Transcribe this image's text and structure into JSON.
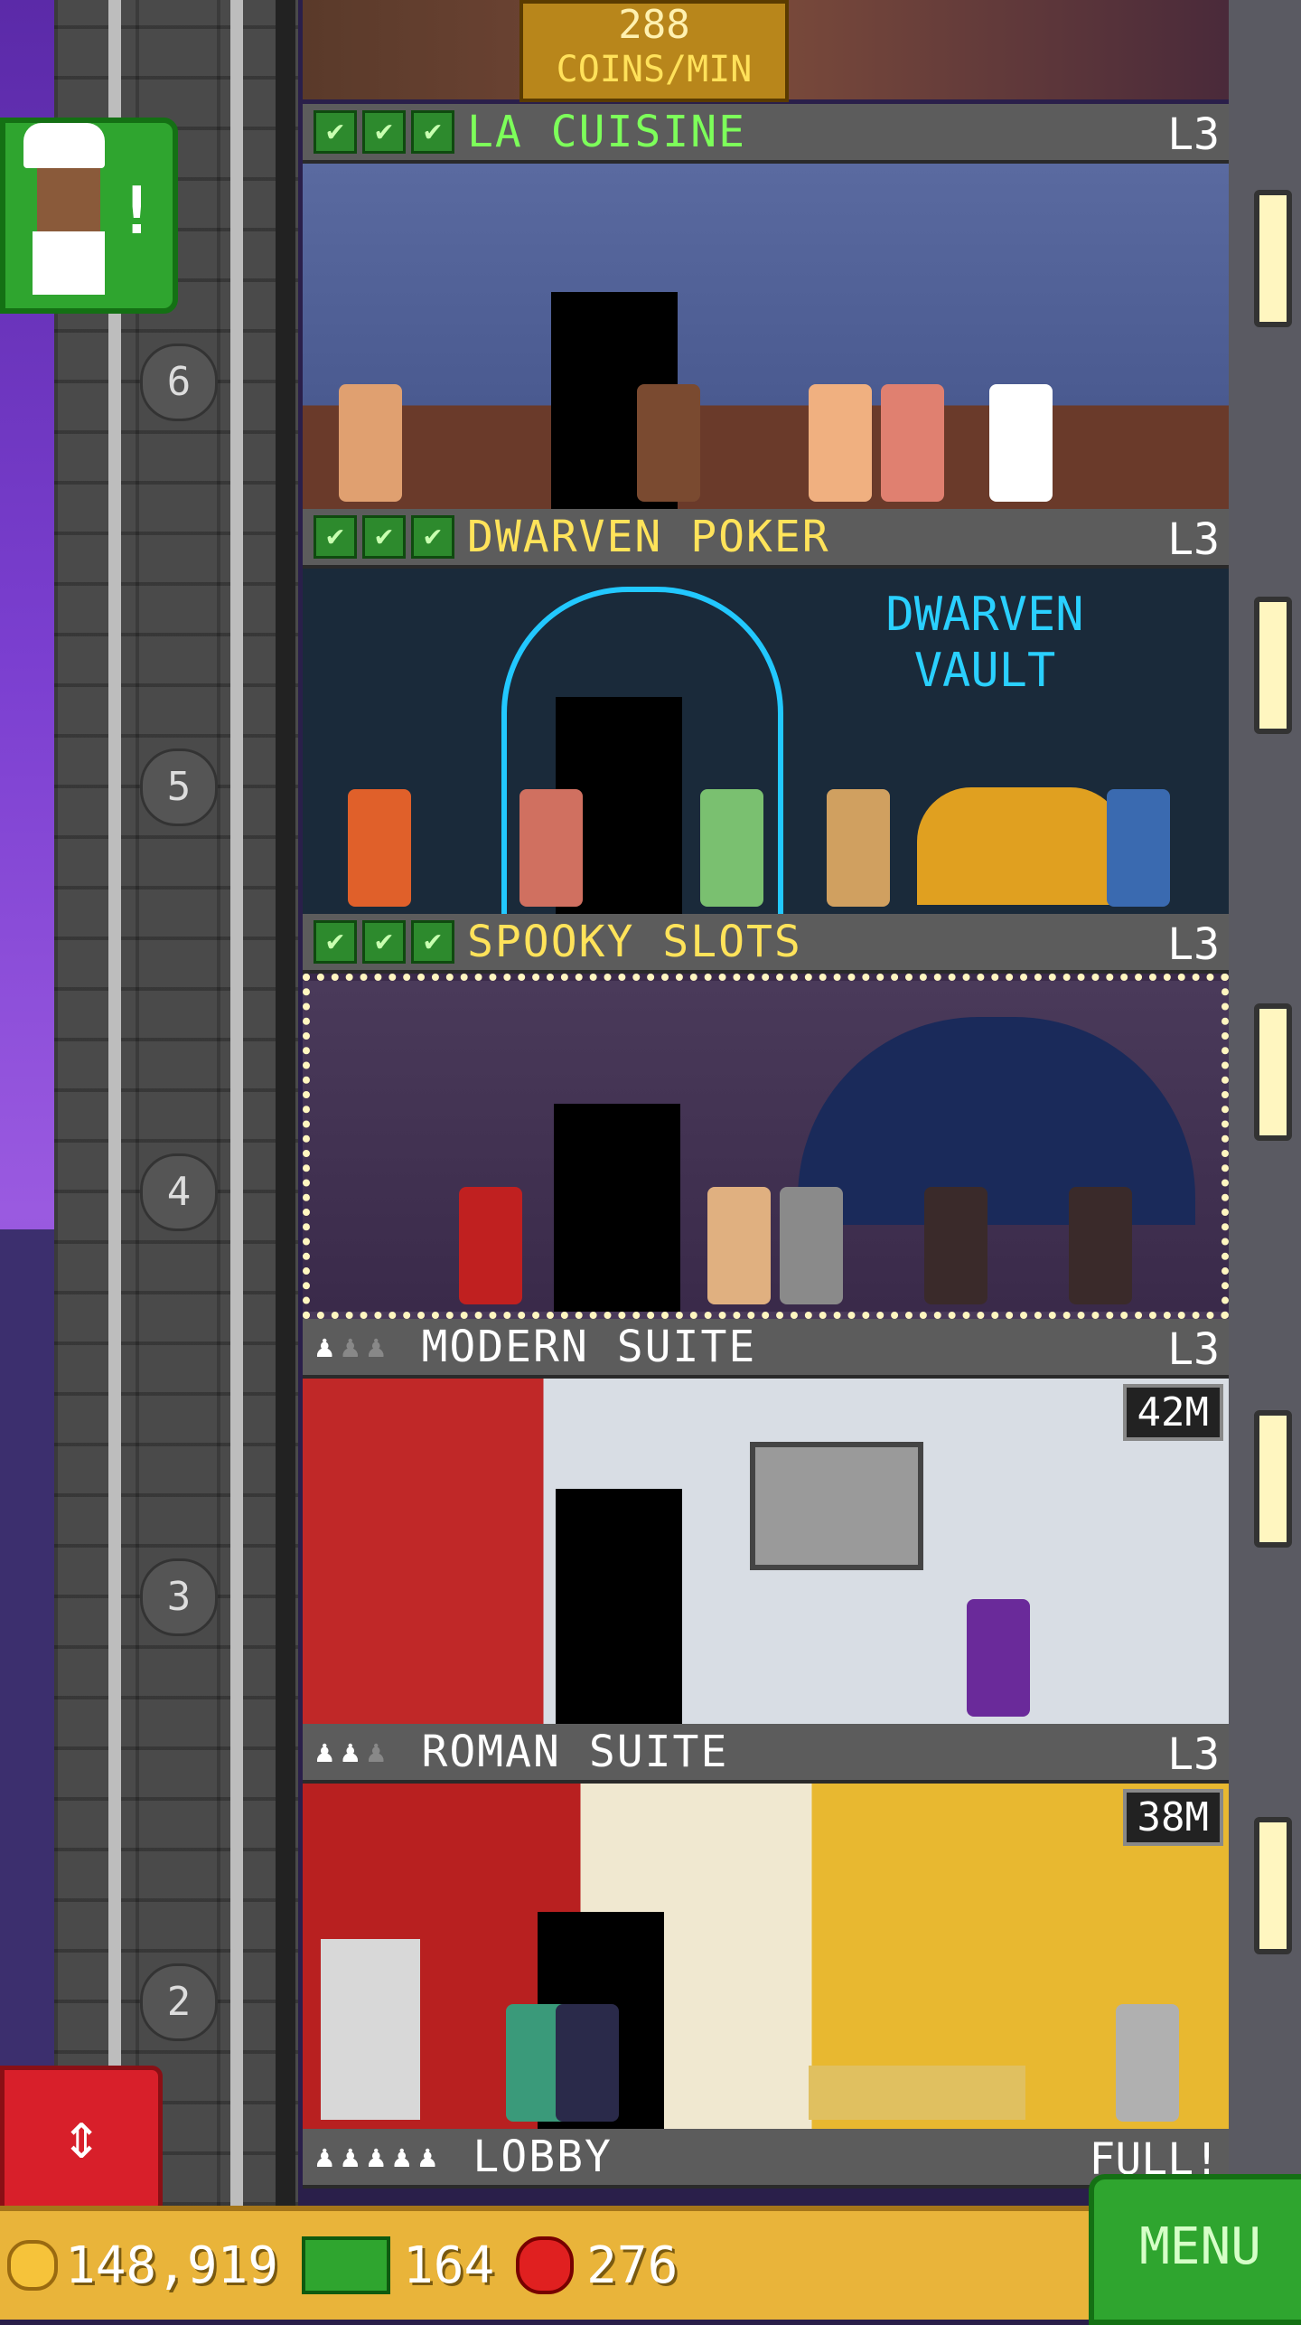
{
  "top": {
    "rate_value": "288",
    "rate_unit": "COINS/MIN"
  },
  "chef_notification": {
    "icon": "chef-icon",
    "badge": "!"
  },
  "elevator_numbers": [
    "6",
    "5",
    "4",
    "3",
    "2"
  ],
  "floors": [
    {
      "name": "LA CUISINE",
      "level": "L3",
      "checks": [
        "✔",
        "✔",
        "✔"
      ],
      "name_color": "#7dff5a"
    },
    {
      "name": "DWARVEN POKER",
      "level": "L3",
      "checks": [
        "✔",
        "✔",
        "✔"
      ],
      "name_color": "#ffe35a",
      "sign": "DWARVEN VAULT"
    },
    {
      "name": "SPOOKY SLOTS",
      "level": "L3",
      "checks": [
        "✔",
        "✔",
        "✔"
      ],
      "name_color": "#ffe35a"
    },
    {
      "name": "MODERN SUITE",
      "level": "L3",
      "price": "42M",
      "people": [
        "♟",
        "♟",
        "♟"
      ]
    },
    {
      "name": "ROMAN SUITE",
      "level": "L3",
      "price": "38M",
      "people": [
        "♟",
        "♟",
        "♟"
      ]
    },
    {
      "name": "LOBBY",
      "status": "FULL!",
      "people": [
        "♟",
        "♟",
        "♟",
        "♟",
        "♟"
      ]
    }
  ],
  "bottom_bar": {
    "coins": "148,919",
    "bux": "164",
    "gems": "276",
    "menu": "MENU"
  },
  "colors": {
    "menu_green": "#2fa52f",
    "elevator_red": "#d81f2a",
    "bar_gold": "#e9b43a"
  }
}
